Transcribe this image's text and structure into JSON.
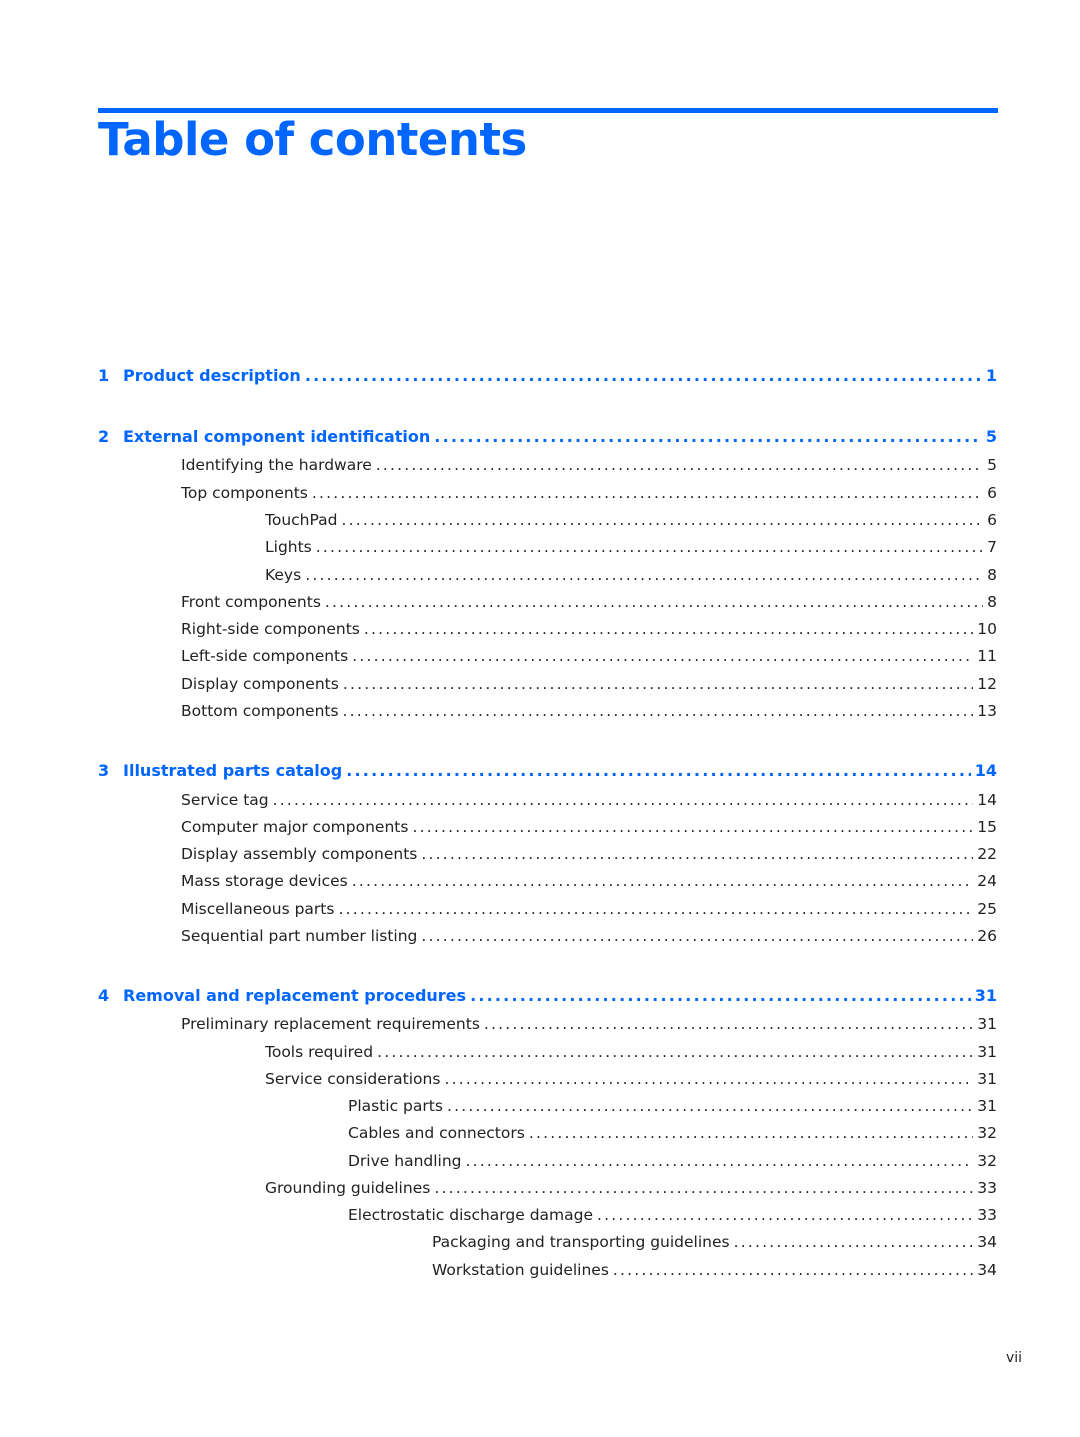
{
  "page": {
    "title": "Table of contents",
    "folio": "vii",
    "accent_color": "#0066ff"
  },
  "toc": [
    {
      "level": 0,
      "number": "1",
      "label": "Product description",
      "page": "1"
    },
    {
      "level": 0,
      "number": "2",
      "label": "External component identification",
      "page": "5"
    },
    {
      "level": 1,
      "label": "Identifying the hardware",
      "page": "5"
    },
    {
      "level": 1,
      "label": "Top components",
      "page": "6"
    },
    {
      "level": 2,
      "label": "TouchPad",
      "page": "6"
    },
    {
      "level": 2,
      "label": "Lights",
      "page": "7"
    },
    {
      "level": 2,
      "label": "Keys",
      "page": "8"
    },
    {
      "level": 1,
      "label": "Front components",
      "page": "8"
    },
    {
      "level": 1,
      "label": "Right-side components",
      "page": "10"
    },
    {
      "level": 1,
      "label": "Left-side components",
      "page": "11"
    },
    {
      "level": 1,
      "label": "Display components",
      "page": "12"
    },
    {
      "level": 1,
      "label": "Bottom components",
      "page": "13"
    },
    {
      "level": 0,
      "number": "3",
      "label": "Illustrated parts catalog",
      "page": "14"
    },
    {
      "level": 1,
      "label": "Service tag",
      "page": "14"
    },
    {
      "level": 1,
      "label": "Computer major components",
      "page": "15"
    },
    {
      "level": 1,
      "label": "Display assembly components",
      "page": "22"
    },
    {
      "level": 1,
      "label": "Mass storage devices",
      "page": "24"
    },
    {
      "level": 1,
      "label": "Miscellaneous parts",
      "page": "25"
    },
    {
      "level": 1,
      "label": "Sequential part number listing",
      "page": "26"
    },
    {
      "level": 0,
      "number": "4",
      "label": "Removal and replacement procedures",
      "page": "31"
    },
    {
      "level": 1,
      "label": "Preliminary replacement requirements",
      "page": "31"
    },
    {
      "level": 2,
      "label": "Tools required",
      "page": "31"
    },
    {
      "level": 2,
      "label": "Service considerations",
      "page": "31"
    },
    {
      "level": 3,
      "label": "Plastic parts",
      "page": "31"
    },
    {
      "level": 3,
      "label": "Cables and connectors",
      "page": "32"
    },
    {
      "level": 3,
      "label": "Drive handling",
      "page": "32"
    },
    {
      "level": 2,
      "label": "Grounding guidelines",
      "page": "33"
    },
    {
      "level": 3,
      "label": "Electrostatic discharge damage",
      "page": "33"
    },
    {
      "level": 4,
      "label": "Packaging and transporting guidelines",
      "page": "34"
    },
    {
      "level": 4,
      "label": "Workstation guidelines",
      "page": "34"
    }
  ]
}
